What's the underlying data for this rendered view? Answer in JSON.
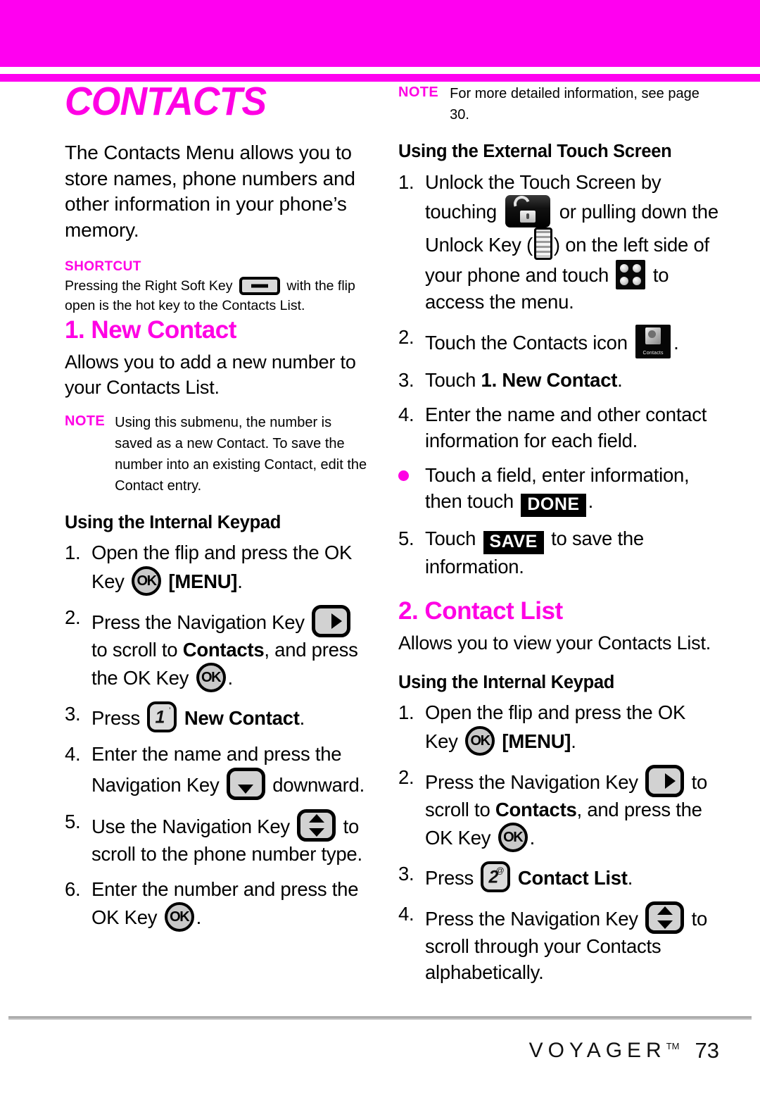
{
  "colors": {
    "accent_magenta": "#ff00f0",
    "heading_magenta": "#ff00e4",
    "black": "#000000"
  },
  "chapter": {
    "title": "CONTACTS",
    "intro": "The Contacts Menu allows you to store names, phone numbers and other information in your phone’s memory."
  },
  "shortcut": {
    "label": "SHORTCUT",
    "text_before": "Pressing the Right Soft Key",
    "text_after": "with the flip open is the hot key to the Contacts List."
  },
  "section_new_contact": {
    "title": "1. New Contact",
    "description": "Allows you to add a new number to your Contacts List.",
    "note_label": "NOTE",
    "note_text": "Using this submenu, the number is saved as a new Contact. To save the number into an existing Contact, edit the Contact entry.",
    "internal_keypad_heading": "Using the Internal Keypad",
    "steps": [
      {
        "num": "1.",
        "part1": "Open the flip and press the OK Key",
        "icon": "ok-key-icon",
        "part2": "[MENU]",
        "part2_bold": true,
        "part3": "."
      },
      {
        "num": "2.",
        "part1": "Press the Navigation Key",
        "icon": "nav-key-right-icon",
        "part2": "to scroll to",
        "bold_word": "Contacts",
        "part3": ", and press the OK Key",
        "icon2": "ok-key-icon",
        "part4": "."
      },
      {
        "num": "3.",
        "part1": "Press",
        "icon": "keypad-1-icon",
        "part2": "New Contact",
        "part3": "."
      },
      {
        "num": "4.",
        "part1": "Enter the name and press the Navigation Key",
        "icon": "nav-key-down-icon",
        "part2": "downward."
      },
      {
        "num": "5.",
        "part1": "Use the Navigation Key",
        "icon": "nav-key-updown-icon",
        "part2": "to scroll to the phone number type."
      },
      {
        "num": "6.",
        "part1": "Enter the number and press the OK Key",
        "icon": "ok-key-icon",
        "part2": "."
      }
    ]
  },
  "right_note": {
    "label": "NOTE",
    "text": "For more detailed information, see page 30."
  },
  "external_touch": {
    "heading": "Using the External Touch Screen",
    "steps": [
      {
        "num": "1.",
        "part1": "Unlock the Touch Screen by touching",
        "icon": "unlock-button-icon",
        "part2": "or pulling down the Unlock Key (",
        "icon2": "unlock-ribbed-key-icon",
        "part3": ") on the left side of your phone and touch",
        "icon3": "menu-grid-icon",
        "part4": "to access the menu."
      },
      {
        "num": "2.",
        "part1": "Touch the Contacts icon",
        "icon": "contacts-app-icon",
        "part2": "."
      },
      {
        "num": "3.",
        "part1": "Touch",
        "bold_word": "1. New Contact",
        "part2": "."
      },
      {
        "num": "4.",
        "part1": "Enter the name and other contact information for each field."
      },
      {
        "num": "•",
        "part1": "Touch a field, enter information, then touch",
        "button": "DONE",
        "part2": "."
      },
      {
        "num": "5.",
        "part1": "Touch",
        "button": "SAVE",
        "part2": "to save the information."
      }
    ]
  },
  "section_contact_list": {
    "title": "2. Contact List",
    "description": "Allows you to view your Contacts List.",
    "internal_keypad_heading": "Using the Internal Keypad",
    "steps": [
      {
        "num": "1.",
        "part1": "Open the flip and press the OK Key",
        "icon": "ok-key-icon",
        "part2": "[MENU]",
        "part3": "."
      },
      {
        "num": "2.",
        "part1": "Press the Navigation Key",
        "icon": "nav-key-right-icon",
        "part2": "to scroll to",
        "bold_word": "Contacts",
        "part3": ", and press the OK Key",
        "icon2": "ok-key-icon",
        "part4": "."
      },
      {
        "num": "3.",
        "part1": "Press",
        "icon": "keypad-2-icon",
        "part2": "Contact List",
        "part3": "."
      },
      {
        "num": "4.",
        "part1": "Press the Navigation Key",
        "icon": "nav-key-updown-icon",
        "part2": "to scroll through your Contacts alphabetically."
      }
    ]
  },
  "icons": {
    "ok_key_label": "OK",
    "keypad_1_digit": "1",
    "keypad_1_sup": "’",
    "keypad_2_digit": "2",
    "keypad_2_sup": "@",
    "contacts_icon_caption": "Contacts",
    "done_button": "DONE",
    "save_button": "SAVE"
  },
  "footer": {
    "brand": "VOYAGER",
    "trademark": "TM",
    "page_number": "73"
  }
}
